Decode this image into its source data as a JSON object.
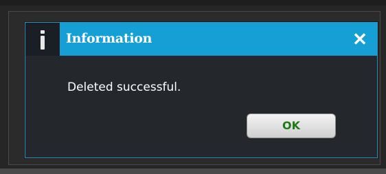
{
  "dialog": {
    "title": "Information",
    "message": "Deleted successful.",
    "ok_label": "OK",
    "close_glyph": "✕",
    "icons": {
      "info": "info-icon",
      "close": "close-icon"
    }
  },
  "colors": {
    "titlebar": "#159fd5",
    "dialog_background": "#24282c",
    "ok_text": "#1f7a16"
  }
}
